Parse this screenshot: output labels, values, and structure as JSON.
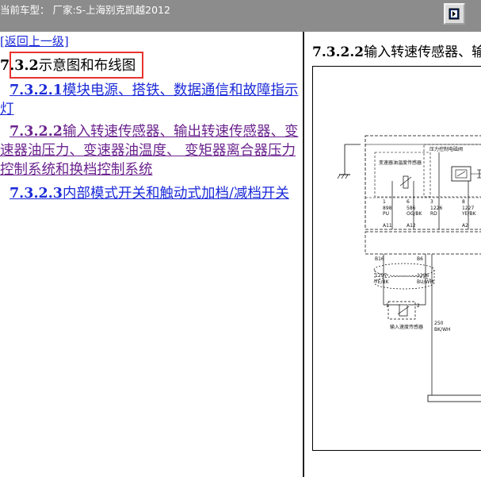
{
  "topbar": {
    "title": "当前车型：  厂家:S-上海别克凯越2012"
  },
  "nav": {
    "back_label": "[返回上一级]"
  },
  "section": {
    "number": "7.3.2",
    "name": "示意图和布线图"
  },
  "toc": [
    {
      "number": "7.3.2.1",
      "text": "模块电源、搭铁、数据通信和故障指示灯"
    },
    {
      "number": "7.3.2.2",
      "text": "输入转速传感器、输出转速传感器、变速器油压力、变速器油温度、 变矩器离合器压力控制系统和换档控制系统"
    },
    {
      "number": "7.3.2.3",
      "text": "内部模式开关和触动式加档/减档开关"
    }
  ],
  "content": {
    "title_number": "7.3.2.2",
    "title_text": "输入转速传感器、输出转速传感器、变速器油压力、变速器油温度、变矩器离合器压力控制系统和换档控制系统"
  },
  "diagram": {
    "labels": {
      "temp_sensor": "变速器油温度传感器",
      "pressure_solenoid": "压力控制电磁阀",
      "input_speed_sensor": "输入速度传感器"
    },
    "pins": [
      {
        "num": "1",
        "circuit": "898",
        "color": "PU",
        "conn": "A11"
      },
      {
        "num": "6",
        "circuit": "586",
        "color": "OG/BK",
        "conn": "A12"
      },
      {
        "num": "3",
        "circuit": "1226",
        "color": "RD",
        "conn": ""
      },
      {
        "num": "8",
        "circuit": "1227",
        "color": "YE/BK",
        "conn": "A2"
      }
    ],
    "lower_wires": [
      {
        "conn": "B16",
        "circuit": "1297",
        "color": "YE/BK"
      },
      {
        "conn": "B6",
        "circuit": "1296",
        "color": "BU/WH"
      }
    ],
    "sensor_pins": [
      "1",
      "2"
    ],
    "ground_wire": {
      "circuit": "250",
      "color": "BK/WH"
    }
  }
}
